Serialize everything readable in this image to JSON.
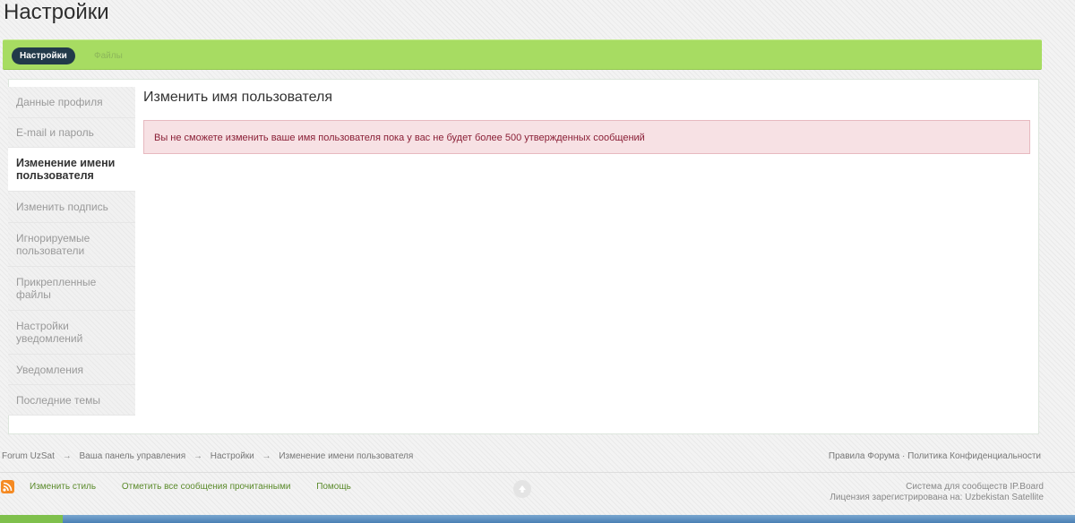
{
  "page_title": "Настройки",
  "tabs": [
    {
      "label": "Настройки",
      "active": true
    },
    {
      "label": "Файлы",
      "active": false
    }
  ],
  "sidebar": {
    "items": [
      {
        "label": "Данные профиля"
      },
      {
        "label": "E-mail и пароль"
      },
      {
        "label": "Изменение имени пользователя",
        "active": true
      },
      {
        "label": "Изменить подпись"
      },
      {
        "label": "Игнорируемые пользователи"
      },
      {
        "label": "Прикрепленные файлы"
      },
      {
        "label": "Настройки уведомлений"
      },
      {
        "label": "Уведомления"
      },
      {
        "label": "Последние темы"
      }
    ]
  },
  "main": {
    "title": "Изменить имя пользователя",
    "alert": "Вы не сможете изменить ваше имя пользователя пока у вас не будет более 500 утвержденных сообщений"
  },
  "breadcrumb": {
    "items": [
      "Forum UzSat",
      "Ваша панель управления",
      "Настройки",
      "Изменение имени пользователя"
    ],
    "separator": "→"
  },
  "footer": {
    "rules": "Правила Форума",
    "dot": "·",
    "privacy": "Политика Конфиденциальности",
    "links": [
      "Изменить стиль",
      "Отметить все сообщения прочитанными",
      "Помощь"
    ],
    "credits_line1": "Система для сообществ IP.Board",
    "credits_line2": "Лицензия зарегистрирована на: Uzbekistan Satellite"
  },
  "colors": {
    "tabbar": "#a7dc62",
    "active_tab": "#223a4a",
    "alert_bg": "#f7e1e4",
    "alert_text": "#8a1f36",
    "rss": "#f58a23"
  },
  "icons": {
    "rss": "rss-icon",
    "scroll_top": "arrow-up-icon"
  }
}
